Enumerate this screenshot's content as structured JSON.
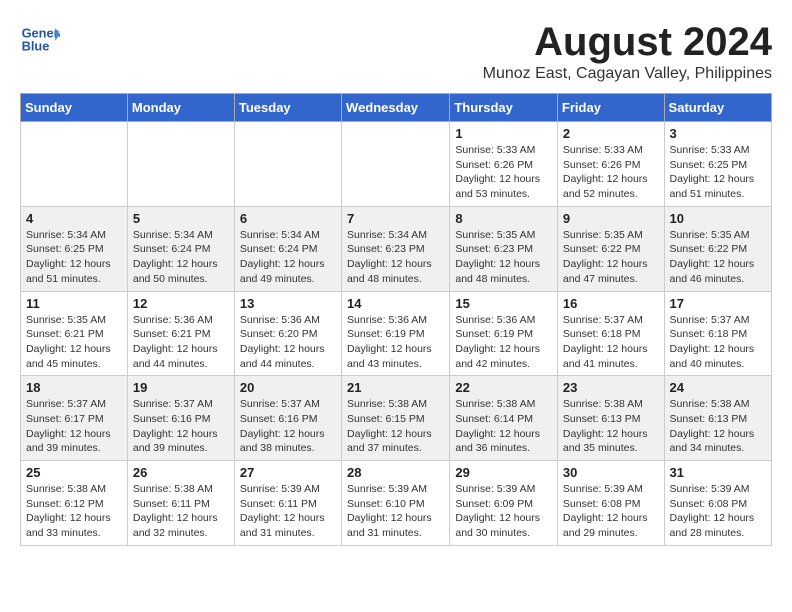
{
  "header": {
    "logo_line1": "General",
    "logo_line2": "Blue",
    "month": "August 2024",
    "location": "Munoz East, Cagayan Valley, Philippines"
  },
  "weekdays": [
    "Sunday",
    "Monday",
    "Tuesday",
    "Wednesday",
    "Thursday",
    "Friday",
    "Saturday"
  ],
  "weeks": [
    [
      {
        "day": "",
        "info": ""
      },
      {
        "day": "",
        "info": ""
      },
      {
        "day": "",
        "info": ""
      },
      {
        "day": "",
        "info": ""
      },
      {
        "day": "1",
        "info": "Sunrise: 5:33 AM\nSunset: 6:26 PM\nDaylight: 12 hours\nand 53 minutes."
      },
      {
        "day": "2",
        "info": "Sunrise: 5:33 AM\nSunset: 6:26 PM\nDaylight: 12 hours\nand 52 minutes."
      },
      {
        "day": "3",
        "info": "Sunrise: 5:33 AM\nSunset: 6:25 PM\nDaylight: 12 hours\nand 51 minutes."
      }
    ],
    [
      {
        "day": "4",
        "info": "Sunrise: 5:34 AM\nSunset: 6:25 PM\nDaylight: 12 hours\nand 51 minutes."
      },
      {
        "day": "5",
        "info": "Sunrise: 5:34 AM\nSunset: 6:24 PM\nDaylight: 12 hours\nand 50 minutes."
      },
      {
        "day": "6",
        "info": "Sunrise: 5:34 AM\nSunset: 6:24 PM\nDaylight: 12 hours\nand 49 minutes."
      },
      {
        "day": "7",
        "info": "Sunrise: 5:34 AM\nSunset: 6:23 PM\nDaylight: 12 hours\nand 48 minutes."
      },
      {
        "day": "8",
        "info": "Sunrise: 5:35 AM\nSunset: 6:23 PM\nDaylight: 12 hours\nand 48 minutes."
      },
      {
        "day": "9",
        "info": "Sunrise: 5:35 AM\nSunset: 6:22 PM\nDaylight: 12 hours\nand 47 minutes."
      },
      {
        "day": "10",
        "info": "Sunrise: 5:35 AM\nSunset: 6:22 PM\nDaylight: 12 hours\nand 46 minutes."
      }
    ],
    [
      {
        "day": "11",
        "info": "Sunrise: 5:35 AM\nSunset: 6:21 PM\nDaylight: 12 hours\nand 45 minutes."
      },
      {
        "day": "12",
        "info": "Sunrise: 5:36 AM\nSunset: 6:21 PM\nDaylight: 12 hours\nand 44 minutes."
      },
      {
        "day": "13",
        "info": "Sunrise: 5:36 AM\nSunset: 6:20 PM\nDaylight: 12 hours\nand 44 minutes."
      },
      {
        "day": "14",
        "info": "Sunrise: 5:36 AM\nSunset: 6:19 PM\nDaylight: 12 hours\nand 43 minutes."
      },
      {
        "day": "15",
        "info": "Sunrise: 5:36 AM\nSunset: 6:19 PM\nDaylight: 12 hours\nand 42 minutes."
      },
      {
        "day": "16",
        "info": "Sunrise: 5:37 AM\nSunset: 6:18 PM\nDaylight: 12 hours\nand 41 minutes."
      },
      {
        "day": "17",
        "info": "Sunrise: 5:37 AM\nSunset: 6:18 PM\nDaylight: 12 hours\nand 40 minutes."
      }
    ],
    [
      {
        "day": "18",
        "info": "Sunrise: 5:37 AM\nSunset: 6:17 PM\nDaylight: 12 hours\nand 39 minutes."
      },
      {
        "day": "19",
        "info": "Sunrise: 5:37 AM\nSunset: 6:16 PM\nDaylight: 12 hours\nand 39 minutes."
      },
      {
        "day": "20",
        "info": "Sunrise: 5:37 AM\nSunset: 6:16 PM\nDaylight: 12 hours\nand 38 minutes."
      },
      {
        "day": "21",
        "info": "Sunrise: 5:38 AM\nSunset: 6:15 PM\nDaylight: 12 hours\nand 37 minutes."
      },
      {
        "day": "22",
        "info": "Sunrise: 5:38 AM\nSunset: 6:14 PM\nDaylight: 12 hours\nand 36 minutes."
      },
      {
        "day": "23",
        "info": "Sunrise: 5:38 AM\nSunset: 6:13 PM\nDaylight: 12 hours\nand 35 minutes."
      },
      {
        "day": "24",
        "info": "Sunrise: 5:38 AM\nSunset: 6:13 PM\nDaylight: 12 hours\nand 34 minutes."
      }
    ],
    [
      {
        "day": "25",
        "info": "Sunrise: 5:38 AM\nSunset: 6:12 PM\nDaylight: 12 hours\nand 33 minutes."
      },
      {
        "day": "26",
        "info": "Sunrise: 5:38 AM\nSunset: 6:11 PM\nDaylight: 12 hours\nand 32 minutes."
      },
      {
        "day": "27",
        "info": "Sunrise: 5:39 AM\nSunset: 6:11 PM\nDaylight: 12 hours\nand 31 minutes."
      },
      {
        "day": "28",
        "info": "Sunrise: 5:39 AM\nSunset: 6:10 PM\nDaylight: 12 hours\nand 31 minutes."
      },
      {
        "day": "29",
        "info": "Sunrise: 5:39 AM\nSunset: 6:09 PM\nDaylight: 12 hours\nand 30 minutes."
      },
      {
        "day": "30",
        "info": "Sunrise: 5:39 AM\nSunset: 6:08 PM\nDaylight: 12 hours\nand 29 minutes."
      },
      {
        "day": "31",
        "info": "Sunrise: 5:39 AM\nSunset: 6:08 PM\nDaylight: 12 hours\nand 28 minutes."
      }
    ]
  ]
}
